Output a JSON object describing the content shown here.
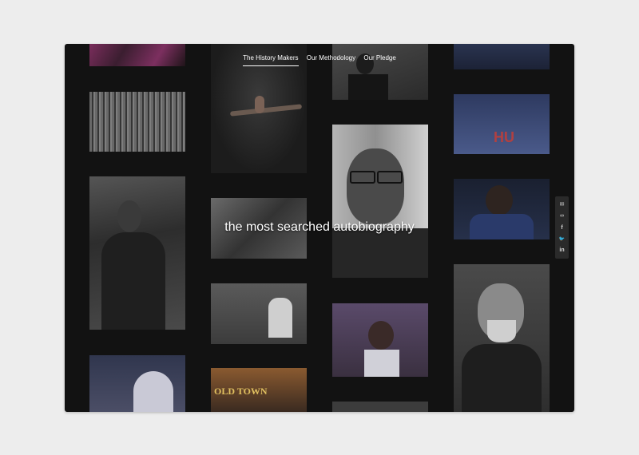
{
  "nav": {
    "items": [
      {
        "label": "The History Makers",
        "active": true
      },
      {
        "label": "Our Methodology",
        "active": false
      },
      {
        "label": "Our Pledge",
        "active": false
      }
    ]
  },
  "headline": "the most searched autobiography",
  "share": {
    "email_icon": "✉",
    "link_icon": "∞",
    "facebook_icon": "f",
    "twitter_icon": "🐦",
    "linkedin_icon": "in"
  },
  "photos": {
    "col1": [
      {
        "name": "magenta-fabric-photo",
        "color": "#5a2a48"
      },
      {
        "name": "march-crowd-photo",
        "color": "#6e6e6e"
      },
      {
        "name": "woman-on-bus-photo",
        "color": "#3c3c3c"
      },
      {
        "name": "tennis-player-photo",
        "color": "#3e3f55"
      }
    ],
    "col2": [
      {
        "name": "dancer-leap-photo",
        "color": "#262626"
      },
      {
        "name": "hands-photo",
        "color": "#4c4c4c"
      },
      {
        "name": "scientist-at-desk-photo",
        "color": "#505050"
      },
      {
        "name": "old-town-sign-photo",
        "color": "#6a5030"
      }
    ],
    "col3": [
      {
        "name": "speaker-pointing-photo",
        "color": "#3a3a3a"
      },
      {
        "name": "malcolm-x-portrait-photo",
        "color": "#7a7a7a"
      },
      {
        "name": "singer-photo",
        "color": "#4e4058"
      },
      {
        "name": "bottom-strip-photo",
        "color": "#3a3a3a"
      }
    ],
    "col4": [
      {
        "name": "navy-top-photo",
        "color": "#273045"
      },
      {
        "name": "hu-jersey-photo",
        "color": "#39466c"
      },
      {
        "name": "titans-player-photo",
        "color": "#1e2436"
      },
      {
        "name": "frederick-douglass-portrait-photo",
        "color": "#3a3a3a"
      }
    ]
  }
}
